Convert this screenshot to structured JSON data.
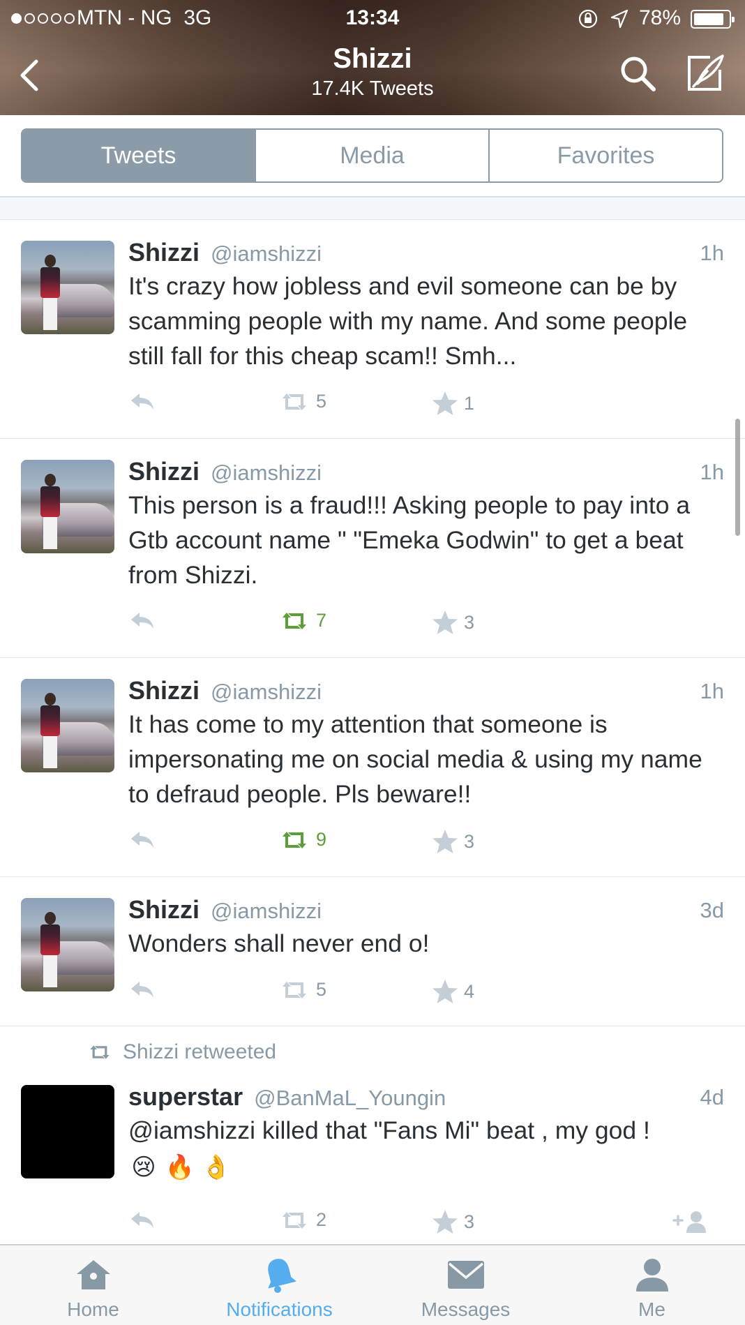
{
  "status_bar": {
    "carrier": "MTN - NG",
    "network": "3G",
    "time": "13:34",
    "battery": "78%",
    "battery_level": 0.78,
    "signal_bars_filled": 1,
    "signal_bars_total": 5
  },
  "header": {
    "title": "Shizzi",
    "subtitle": "17.4K Tweets"
  },
  "segments": [
    {
      "label": "Tweets",
      "active": true
    },
    {
      "label": "Media",
      "active": false
    },
    {
      "label": "Favorites",
      "active": false
    }
  ],
  "tweets": [
    {
      "name": "Shizzi",
      "handle": "@iamshizzi",
      "time": "1h",
      "text": "It's crazy how jobless and evil someone can be by scamming people with my name. And some people still fall for this cheap scam!! Smh...",
      "retweets": "5",
      "favorites": "1",
      "retweeted_by_user": false
    },
    {
      "name": "Shizzi",
      "handle": "@iamshizzi",
      "time": "1h",
      "text": "This person is a fraud!!! Asking people to pay into a Gtb account name \" \"Emeka Godwin\" to get a beat from Shizzi.",
      "retweets": "7",
      "favorites": "3",
      "retweeted_by_user": true
    },
    {
      "name": "Shizzi",
      "handle": "@iamshizzi",
      "time": "1h",
      "text": "It has come to my attention that someone is impersonating me on social media & using my name to defraud people. Pls beware!!",
      "retweets": "9",
      "favorites": "3",
      "retweeted_by_user": true
    },
    {
      "name": "Shizzi",
      "handle": "@iamshizzi",
      "time": "3d",
      "text": "Wonders shall never end o!",
      "retweets": "5",
      "favorites": "4",
      "retweeted_by_user": false
    },
    {
      "retweet_note": "Shizzi retweeted",
      "name": "superstar",
      "handle": "@BanMaL_Youngin",
      "time": "4d",
      "text": "@iamshizzi killed that \"Fans Mi\" beat , my god !",
      "emojis": [
        "😢",
        "🔥",
        "👌"
      ],
      "retweets": "2",
      "favorites": "3",
      "retweeted_by_user": false
    }
  ],
  "tabbar": [
    {
      "label": "Home",
      "icon": "home-icon",
      "active": false
    },
    {
      "label": "Notifications",
      "icon": "bell-icon",
      "active": true
    },
    {
      "label": "Messages",
      "icon": "envelope-icon",
      "active": false
    },
    {
      "label": "Me",
      "icon": "person-icon",
      "active": false
    }
  ],
  "colors": {
    "accent_blue": "#55acee",
    "retweet_green": "#5c9e3a",
    "muted_gray": "#8899a6",
    "segment_active": "#8b9ba7"
  }
}
